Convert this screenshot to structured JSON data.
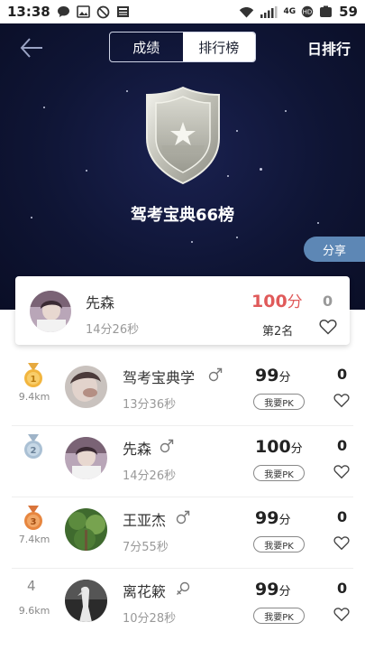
{
  "status_bar": {
    "time": "13:38",
    "network": "4G",
    "battery": "59",
    "icons": [
      "chat-bubble-icon",
      "image-icon",
      "do-not-disturb-icon",
      "news-icon",
      "wifi-icon",
      "signal-icon",
      "hd-icon",
      "battery-icon"
    ]
  },
  "header": {
    "back_icon": "arrow-left-icon",
    "tabs": [
      {
        "label": "成绩",
        "active": false
      },
      {
        "label": "排行榜",
        "active": true
      }
    ],
    "period_label": "日排行"
  },
  "hero": {
    "badge_icon": "shield-star-badge-icon",
    "title": "驾考宝典66榜",
    "share_label": "分享"
  },
  "my_entry": {
    "name": "先森",
    "time": "14分26秒",
    "score": "100",
    "score_unit": "分",
    "rank_text": "第2名",
    "likes": "0"
  },
  "ranking": [
    {
      "rank": "1",
      "medal": "gold-medal-icon",
      "distance": "9.4km",
      "name": "驾考宝典学",
      "gender": "male",
      "time": "13分36秒",
      "score": "99",
      "score_unit": "分",
      "pk_label": "我要PK",
      "likes": "0"
    },
    {
      "rank": "2",
      "medal": "silver-medal-icon",
      "distance": "",
      "name": "先森",
      "gender": "male",
      "time": "14分26秒",
      "score": "100",
      "score_unit": "分",
      "pk_label": "我要PK",
      "likes": "0"
    },
    {
      "rank": "3",
      "medal": "bronze-medal-icon",
      "distance": "7.4km",
      "name": "王亚杰",
      "gender": "male",
      "time": "7分55秒",
      "score": "99",
      "score_unit": "分",
      "pk_label": "我要PK",
      "likes": "0"
    },
    {
      "rank": "4",
      "medal": "",
      "distance": "9.6km",
      "name": "离花簌",
      "gender": "female",
      "time": "10分28秒",
      "score": "99",
      "score_unit": "分",
      "pk_label": "我要PK",
      "likes": "0"
    }
  ],
  "colors": {
    "hero_bg": "#0f1535",
    "accent_red": "#e05a5a",
    "share_blue": "#5d87b5",
    "gold": "#e2a43a",
    "silver": "#a9bfd3",
    "bronze": "#e0823c"
  }
}
